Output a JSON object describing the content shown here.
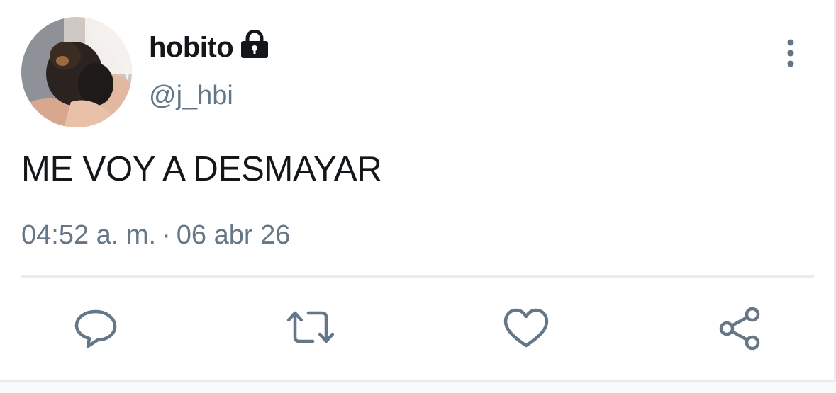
{
  "tweet": {
    "author": {
      "display_name": "hobito",
      "handle": "@j_hbi",
      "protected_icon": "lock-icon",
      "avatar": "profile-photo"
    },
    "text": "ME VOY A DESMAYAR",
    "meta": {
      "time": "04:52 a. m.",
      "separator": "·",
      "date": "06 abr 26"
    },
    "actions": [
      {
        "icon": "reply-icon"
      },
      {
        "icon": "retweet-icon"
      },
      {
        "icon": "like-icon"
      },
      {
        "icon": "share-icon"
      }
    ],
    "menu_icon": "more-vertical-icon",
    "colors": {
      "text": "#14171a",
      "secondary": "#657786",
      "divider": "#e6ecf0"
    }
  }
}
